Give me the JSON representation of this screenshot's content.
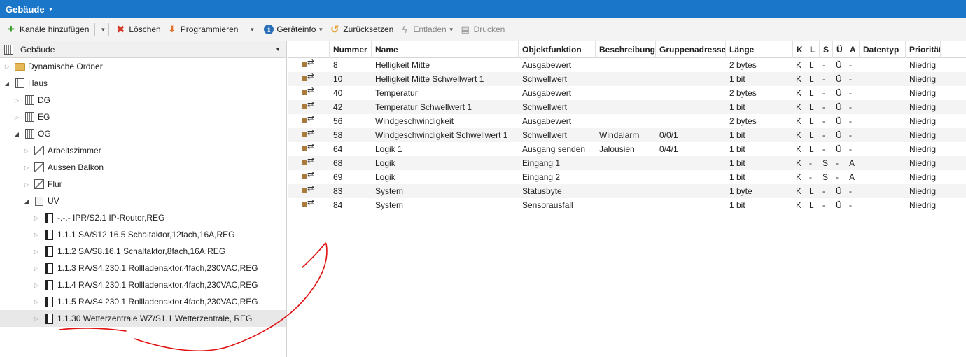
{
  "titlebar": {
    "title": "Gebäude"
  },
  "toolbar": {
    "add_channels": "Kanäle hinzufügen",
    "delete": "Löschen",
    "program": "Programmieren",
    "device_info": "Geräteinfo",
    "reset": "Zurücksetzen",
    "unload": "Entladen",
    "print": "Drucken"
  },
  "tree": {
    "header": "Gebäude",
    "nodes": [
      {
        "label": "Dynamische Ordner",
        "level": 0,
        "icon": "folder-icon",
        "open": false
      },
      {
        "label": "Haus",
        "level": 0,
        "icon": "building-icon",
        "open": true
      },
      {
        "label": "DG",
        "level": 1,
        "icon": "building-icon",
        "open": false
      },
      {
        "label": "EG",
        "level": 1,
        "icon": "building-icon",
        "open": false
      },
      {
        "label": "OG",
        "level": 1,
        "icon": "building-icon",
        "open": true
      },
      {
        "label": "Arbeitszimmer",
        "level": 2,
        "icon": "room-icon",
        "open": false
      },
      {
        "label": "Aussen Balkon",
        "level": 2,
        "icon": "room-icon",
        "open": false
      },
      {
        "label": "Flur",
        "level": 2,
        "icon": "room-icon",
        "open": false
      },
      {
        "label": "UV",
        "level": 2,
        "icon": "distribution-icon",
        "open": true
      },
      {
        "label": "-.-.- IPR/S2.1 IP-Router,REG",
        "level": 3,
        "icon": "device-icon",
        "open": false
      },
      {
        "label": "1.1.1 SA/S12.16.5 Schaltaktor,12fach,16A,REG",
        "level": 3,
        "icon": "device-icon",
        "open": false
      },
      {
        "label": "1.1.2 SA/S8.16.1 Schaltaktor,8fach,16A,REG",
        "level": 3,
        "icon": "device-icon",
        "open": false
      },
      {
        "label": "1.1.3 RA/S4.230.1 Rollladenaktor,4fach,230VAC,REG",
        "level": 3,
        "icon": "device-icon",
        "open": false
      },
      {
        "label": "1.1.4 RA/S4.230.1 Rollladenaktor,4fach,230VAC,REG",
        "level": 3,
        "icon": "device-icon",
        "open": false
      },
      {
        "label": "1.1.5 RA/S4.230.1 Rollladenaktor,4fach,230VAC,REG",
        "level": 3,
        "icon": "device-icon",
        "open": false
      },
      {
        "label": "1.1.30 Wetterzentrale WZ/S1.1 Wetterzentrale, REG",
        "level": 3,
        "icon": "device-icon",
        "open": false,
        "selected": true
      }
    ]
  },
  "table": {
    "columns": [
      "Nummer",
      "Name",
      "Objektfunktion",
      "Beschreibung",
      "Gruppenadresse",
      "Länge",
      "K",
      "L",
      "S",
      "Ü",
      "A",
      "Datentyp",
      "Priorität"
    ],
    "rows": [
      [
        "8",
        "Helligkeit Mitte",
        "Ausgabewert",
        "",
        "",
        "2 bytes",
        "K",
        "L",
        "-",
        "Ü",
        "-",
        "",
        "Niedrig"
      ],
      [
        "10",
        "Helligkeit Mitte Schwellwert 1",
        "Schwellwert",
        "",
        "",
        "1 bit",
        "K",
        "L",
        "-",
        "Ü",
        "-",
        "",
        "Niedrig"
      ],
      [
        "40",
        "Temperatur",
        "Ausgabewert",
        "",
        "",
        "2 bytes",
        "K",
        "L",
        "-",
        "Ü",
        "-",
        "",
        "Niedrig"
      ],
      [
        "42",
        "Temperatur Schwellwert 1",
        "Schwellwert",
        "",
        "",
        "1 bit",
        "K",
        "L",
        "-",
        "Ü",
        "-",
        "",
        "Niedrig"
      ],
      [
        "56",
        "Windgeschwindigkeit",
        "Ausgabewert",
        "",
        "",
        "2 bytes",
        "K",
        "L",
        "-",
        "Ü",
        "-",
        "",
        "Niedrig"
      ],
      [
        "58",
        "Windgeschwindigkeit Schwellwert 1",
        "Schwellwert",
        "Windalarm",
        "0/0/1",
        "1 bit",
        "K",
        "L",
        "-",
        "Ü",
        "-",
        "",
        "Niedrig"
      ],
      [
        "64",
        "Logik 1",
        "Ausgang senden",
        "Jalousien",
        "0/4/1",
        "1 bit",
        "K",
        "L",
        "-",
        "Ü",
        "-",
        "",
        "Niedrig"
      ],
      [
        "68",
        "Logik",
        "Eingang 1",
        "",
        "",
        "1 bit",
        "K",
        "-",
        "S",
        "-",
        "A",
        "",
        "Niedrig"
      ],
      [
        "69",
        "Logik",
        "Eingang 2",
        "",
        "",
        "1 bit",
        "K",
        "-",
        "S",
        "-",
        "A",
        "",
        "Niedrig"
      ],
      [
        "83",
        "System",
        "Statusbyte",
        "",
        "",
        "1 byte",
        "K",
        "L",
        "-",
        "Ü",
        "-",
        "",
        "Niedrig"
      ],
      [
        "84",
        "System",
        "Sensorausfall",
        "",
        "",
        "1 bit",
        "K",
        "L",
        "-",
        "Ü",
        "-",
        "",
        "Niedrig"
      ]
    ]
  },
  "colors": {
    "titlebar": "#1976c8",
    "annotation": "#e01010"
  }
}
